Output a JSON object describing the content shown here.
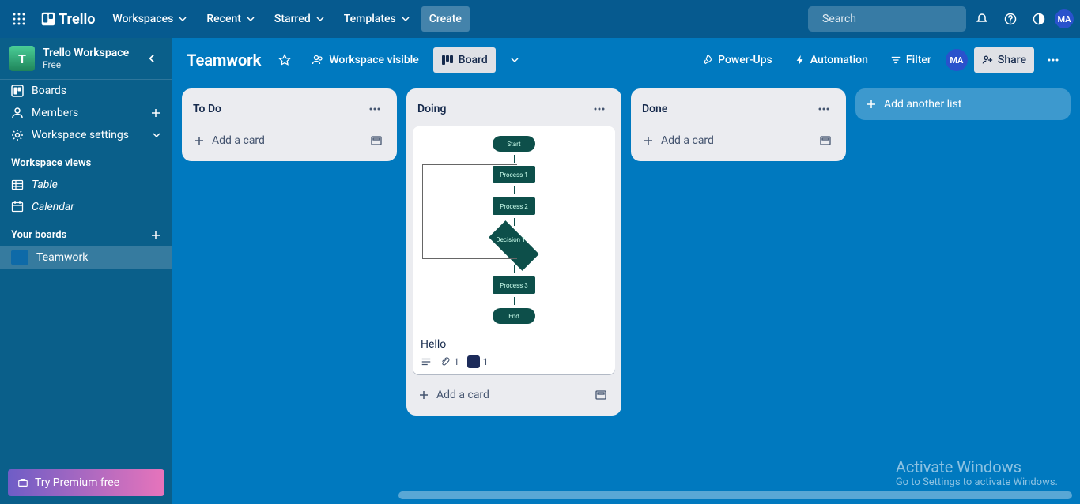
{
  "topnav": {
    "logo": "Trello",
    "menus": [
      "Workspaces",
      "Recent",
      "Starred",
      "Templates"
    ],
    "create": "Create",
    "search_placeholder": "Search",
    "avatar": "MA"
  },
  "sidebar": {
    "workspace_letter": "T",
    "workspace_name": "Trello Workspace",
    "workspace_plan": "Free",
    "nav": {
      "boards": "Boards",
      "members": "Members",
      "settings": "Workspace settings"
    },
    "views_heading": "Workspace views",
    "views": {
      "table": "Table",
      "calendar": "Calendar"
    },
    "yourboards_heading": "Your boards",
    "boards": [
      "Teamwork"
    ],
    "premium": "Try Premium free"
  },
  "board": {
    "title": "Teamwork",
    "visibility": "Workspace visible",
    "view_board": "Board",
    "powerups": "Power-Ups",
    "automation": "Automation",
    "filter": "Filter",
    "share": "Share",
    "member": "MA"
  },
  "lists": [
    {
      "name": "To Do",
      "add": "Add a card",
      "cards": []
    },
    {
      "name": "Doing",
      "add": "Add a card",
      "cards": [
        {
          "title": "Hello",
          "attachments": "1",
          "labels": "1",
          "flowchart": [
            "Start",
            "Process 1",
            "Process 2",
            "Decision 1",
            "Process 3",
            "End"
          ]
        }
      ]
    },
    {
      "name": "Done",
      "add": "Add a card",
      "cards": []
    }
  ],
  "add_list": "Add another list",
  "watermark": {
    "title": "Activate Windows",
    "sub": "Go to Settings to activate Windows."
  }
}
